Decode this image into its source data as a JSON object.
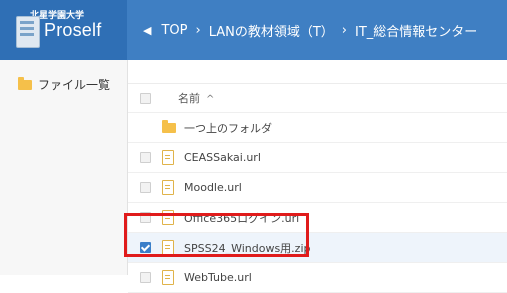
{
  "header": {
    "university": "北星学園大学",
    "app_name": "Proself",
    "back_icon": "chevron-left-icon",
    "breadcrumb": [
      {
        "label": "TOP"
      },
      {
        "label": "LANの教材領域（T）"
      },
      {
        "label": "IT_総合情報センター"
      }
    ]
  },
  "sidebar": {
    "items": [
      {
        "label": "ファイル一覧",
        "icon": "folder-icon"
      }
    ]
  },
  "list": {
    "column_name": "名前",
    "sort_indicator": "^",
    "rows": [
      {
        "name": "一つ上のフォルダ",
        "type": "folder"
      },
      {
        "name": "CEASSakai.url",
        "type": "file"
      },
      {
        "name": "Moodle.url",
        "type": "file"
      },
      {
        "name": "Office365ログイン.url",
        "type": "file"
      },
      {
        "name": "SPSS24_Windows用.zip",
        "type": "file",
        "checked": true
      },
      {
        "name": "WebTube.url",
        "type": "file"
      }
    ]
  },
  "colors": {
    "header_bg": "#3f7fc3",
    "logo_bg": "#2f6fb5",
    "highlight": "#e01b1b",
    "checkbox_checked": "#3b7fc9",
    "folder": "#f5c04a"
  }
}
